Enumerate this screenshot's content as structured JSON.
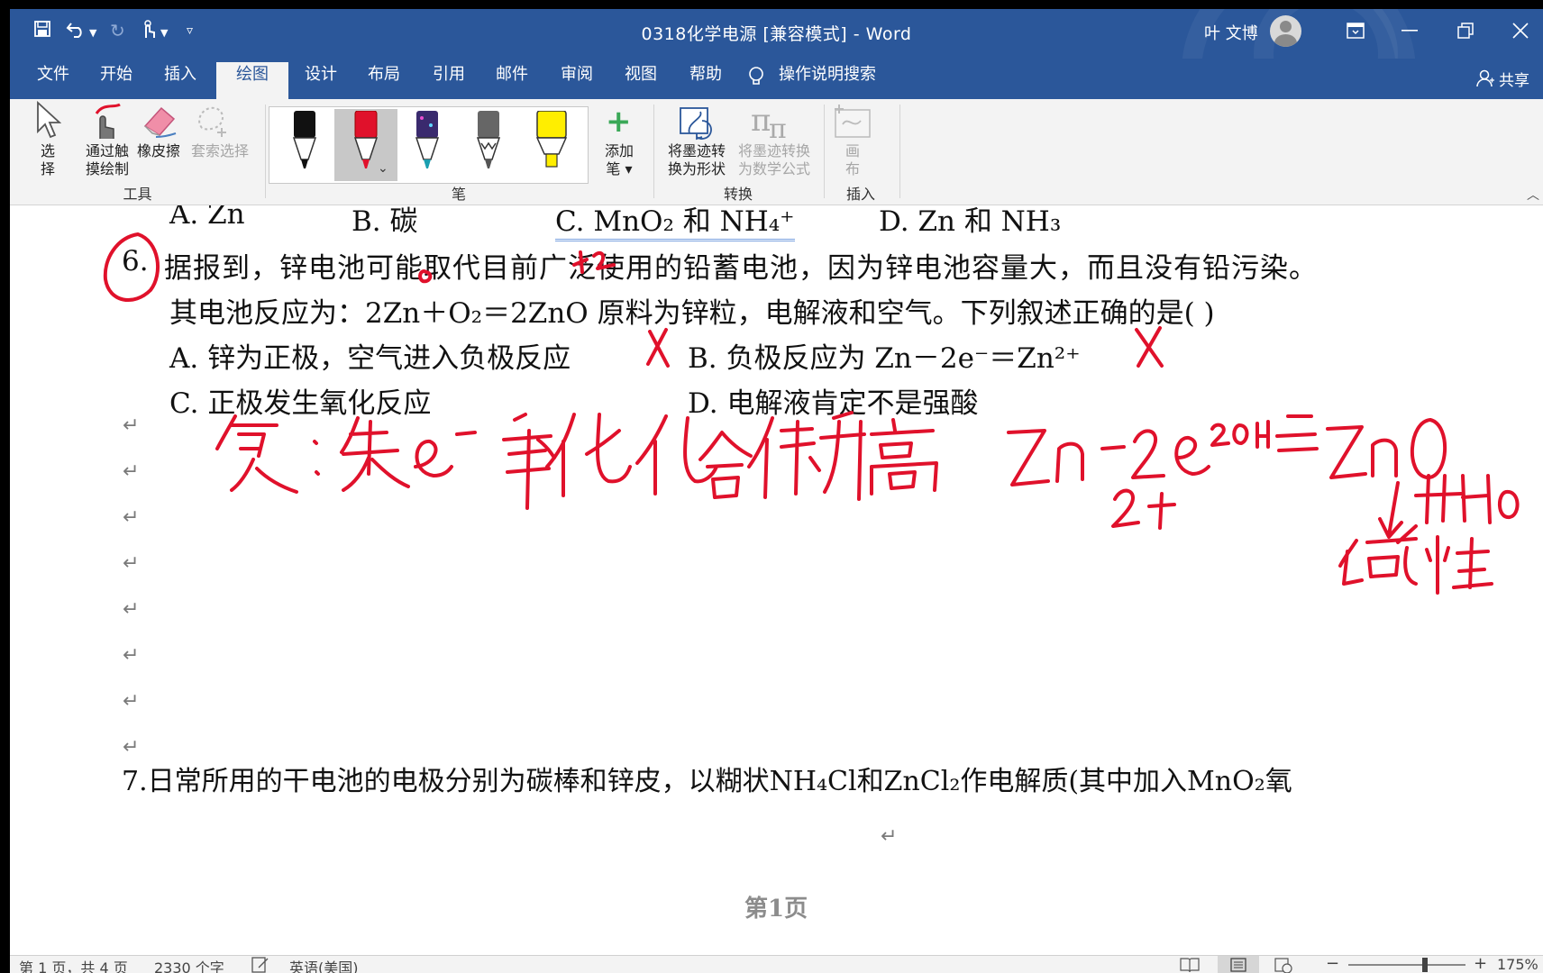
{
  "window": {
    "title": "0318化学电源 [兼容模式] - Word",
    "user_name": "叶 文博",
    "share_label": "共享"
  },
  "tabs": [
    {
      "label": "文件"
    },
    {
      "label": "开始"
    },
    {
      "label": "插入"
    },
    {
      "label": "绘图"
    },
    {
      "label": "设计"
    },
    {
      "label": "布局"
    },
    {
      "label": "引用"
    },
    {
      "label": "邮件"
    },
    {
      "label": "审阅"
    },
    {
      "label": "视图"
    },
    {
      "label": "帮助"
    },
    {
      "label": "操作说明搜索"
    }
  ],
  "ribbon": {
    "select_line1": "选",
    "select_line2": "择",
    "touch_line1": "通过触",
    "touch_line2": "摸绘制",
    "eraser": "橡皮擦",
    "lasso": "套索选择",
    "tools_group": "工具",
    "pens_group": "笔",
    "add_pen_line1": "添加",
    "add_pen_line2": "笔",
    "ink_shape_line1": "将墨迹转",
    "ink_shape_line2": "换为形状",
    "ink_math_line1": "将墨迹转换",
    "ink_math_line2": "为数学公式",
    "convert_group": "转换",
    "canvas_line1": "画",
    "canvas_line2": "布",
    "insert_group": "插入",
    "pen_colors": [
      "#111111",
      "#e0112b",
      "#1a9fb0",
      "#555555",
      "#ffee00"
    ]
  },
  "document": {
    "line_options5_a": "A. Zn",
    "line_options5_b": "B.  碳",
    "line_options5_c": "C. MnO₂ 和 NH₄⁺",
    "line_options5_d": "D. Zn 和 NH₃",
    "q6_number": "6.",
    "q6_text": "据报到，锌电池可能取代目前广泛使用的铅蓄电池，因为锌电池容量大，而且没有铅污染。",
    "q6_text2": "其电池反应为：2Zn＋O₂＝2ZnO 原料为锌粒，电解液和空气。下列叙述正确的是(            )",
    "q6_a": "A.  锌为正极，空气进入负极反应",
    "q6_b": "B.  负极反应为 Zn－2e⁻＝Zn²⁺",
    "q6_c": "C.  正极发生氧化反应",
    "q6_d": "D.  电解液肯定不是强酸",
    "q7_text": "7.日常所用的干电池的电极分别为碳棒和锌皮，以糊状NH₄Cl和ZnCl₂作电解质(其中加入MnO₂氧",
    "page_footer": "第1页",
    "para_mark": "↵"
  },
  "ink": {
    "color": "#e0112b",
    "note_left": "负：失e⁻ 氧化 化合价升高",
    "note_eq": "Zn－2e⁻+2OH⁻＝ZnO",
    "note_2plus": "2+",
    "note_h2o": "+H₂O",
    "note_base": "碱性",
    "mark_zero": "0",
    "mark_plus2": "+2",
    "mark_x": "X"
  },
  "status": {
    "page": "第 1 页，共 4 页",
    "words": "2330 个字",
    "language": "英语(美国)",
    "zoom": "175%"
  }
}
